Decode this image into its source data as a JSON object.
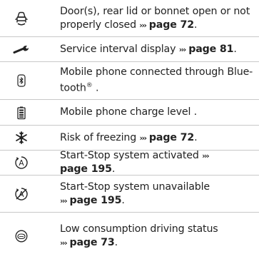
{
  "rows": [
    {
      "icon": "open-door-car-icon",
      "text": "Door(s), rear lid or bonnet open or not properly closed",
      "ref_arrows": "›››",
      "ref": "page 72",
      "suffix": "."
    },
    {
      "icon": "wrench-icon",
      "text": "Service interval display",
      "ref_arrows": "›››",
      "ref": "page 81",
      "suffix": "."
    },
    {
      "icon": "bluetooth-phone-icon",
      "text_a": "Mobile phone connected through Blue-",
      "text_b": "tooth",
      "reg": "®",
      "suffix": " ."
    },
    {
      "icon": "phone-battery-icon",
      "text": "Mobile phone charge level ."
    },
    {
      "icon": "snowflake-icon",
      "text": "Risk of freezing",
      "ref_arrows": "›››",
      "ref": "page 72",
      "suffix": "."
    },
    {
      "icon": "start-stop-active-icon",
      "text": "Start-Stop system activated",
      "ref_arrows": "›››",
      "ref": "page 195",
      "suffix": "."
    },
    {
      "icon": "start-stop-unavailable-icon",
      "text": "Start-Stop system unavailable",
      "ref_arrows": "›››",
      "ref": "page 195",
      "suffix": "."
    },
    {
      "icon": "eco-leaf-icon",
      "text": "Low consumption driving status",
      "ref_arrows": "›››",
      "ref": "page 73",
      "suffix": "."
    }
  ]
}
